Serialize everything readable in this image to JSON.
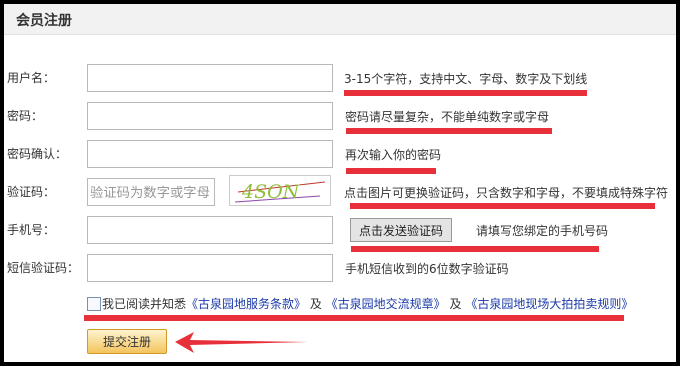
{
  "panel": {
    "title": "会员注册"
  },
  "fields": {
    "username": {
      "label": "用户名：",
      "hint": "3-15个字符，支持中文、字母、数字及下划线"
    },
    "password": {
      "label": "密码：",
      "hint": "密码请尽量复杂，不能单纯数字或字母"
    },
    "confirm": {
      "label": "密码确认：",
      "hint": "再次输入你的密码"
    },
    "captcha": {
      "label": "验证码：",
      "placeholder": "验证码为数字或字母",
      "image_text": "4SON",
      "hint": "点击图片可更换验证码，只含数字和字母，不要填成特殊字符"
    },
    "phone": {
      "label": "手机号：",
      "send_button": "点击发送验证码",
      "hint": "请填写您绑定的手机号码"
    },
    "sms": {
      "label": "短信验证码：",
      "hint": "手机短信收到的6位数字验证码"
    }
  },
  "agreement": {
    "prefix": "我已阅读并知悉",
    "link1": "《古泉园地服务条款》",
    "sep1": " 及 ",
    "link2": "《古泉园地交流规章》",
    "sep2": " 及 ",
    "link3": "《古泉园地现场大拍拍卖规则》"
  },
  "submit_label": "提交注册",
  "colors": {
    "annotation_red": "#e8303a",
    "link_blue": "#1a3aa8",
    "button_gold": "#f3c45d"
  }
}
